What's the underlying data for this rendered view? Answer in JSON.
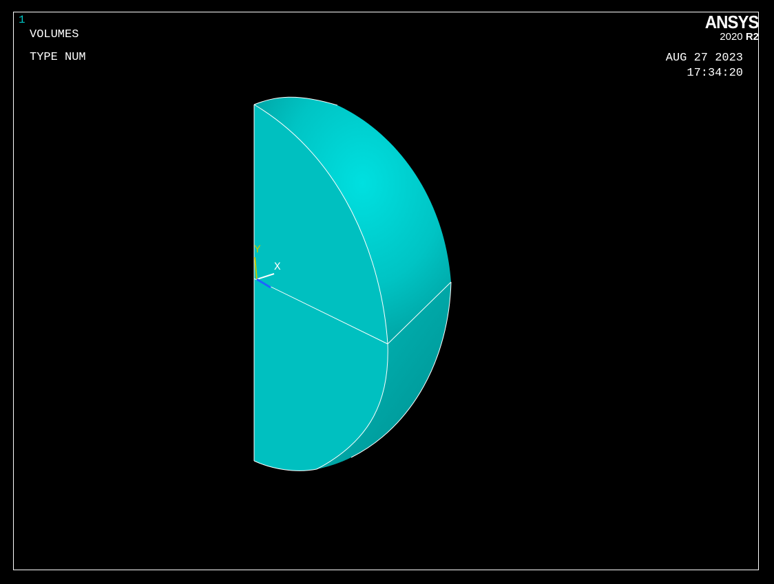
{
  "window_number": "1",
  "plot": {
    "title": "VOLUMES",
    "subtitle": "TYPE NUM"
  },
  "branding": {
    "product": "ANSYS",
    "version_year": "2020",
    "version_release": "R2"
  },
  "timestamp": {
    "date": "AUG 27 2023",
    "time": "17:34:20"
  },
  "triad": {
    "y_label": "Y",
    "x_label": "X"
  },
  "colors": {
    "background": "#000000",
    "volume_fill": "#00c0c0",
    "volume_highlight": "#00dcdc",
    "edge_lines": "#ffffff",
    "triad_y": "#c8c800",
    "triad_z": "#1e64ff"
  }
}
